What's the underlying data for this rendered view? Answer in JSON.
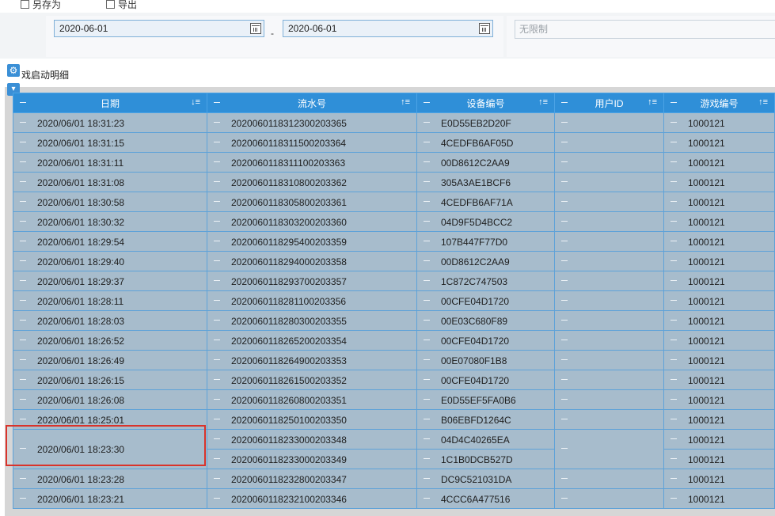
{
  "toolbar": {
    "save_as": "另存为",
    "export": "导出"
  },
  "filters": {
    "start_date": "2020-06-01",
    "separator": "-",
    "end_date": "2020-06-01",
    "unlimited_placeholder": "无限制"
  },
  "section": {
    "title": "戏启动明细"
  },
  "table": {
    "columns": [
      {
        "label": "日期",
        "sort": "↓≡"
      },
      {
        "label": "流水号",
        "sort": "↑≡"
      },
      {
        "label": "设备编号",
        "sort": "↑≡"
      },
      {
        "label": "用户ID",
        "sort": "↑≡"
      },
      {
        "label": "游戏编号",
        "sort": "↑≡"
      }
    ],
    "rows": [
      {
        "date": "2020/06/01 18:31:23",
        "serial": "2020060118312300203365",
        "device": "E0D55EB2D20F",
        "user": "",
        "game": "1000121"
      },
      {
        "date": "2020/06/01 18:31:15",
        "serial": "2020060118311500203364",
        "device": "4CEDFB6AF05D",
        "user": "",
        "game": "1000121"
      },
      {
        "date": "2020/06/01 18:31:11",
        "serial": "2020060118311100203363",
        "device": "00D8612C2AA9",
        "user": "",
        "game": "1000121"
      },
      {
        "date": "2020/06/01 18:31:08",
        "serial": "2020060118310800203362",
        "device": "305A3AE1BCF6",
        "user": "",
        "game": "1000121"
      },
      {
        "date": "2020/06/01 18:30:58",
        "serial": "2020060118305800203361",
        "device": "4CEDFB6AF71A",
        "user": "",
        "game": "1000121"
      },
      {
        "date": "2020/06/01 18:30:32",
        "serial": "2020060118303200203360",
        "device": "04D9F5D4BCC2",
        "user": "",
        "game": "1000121"
      },
      {
        "date": "2020/06/01 18:29:54",
        "serial": "2020060118295400203359",
        "device": "107B447F77D0",
        "user": "",
        "game": "1000121"
      },
      {
        "date": "2020/06/01 18:29:40",
        "serial": "2020060118294000203358",
        "device": "00D8612C2AA9",
        "user": "",
        "game": "1000121"
      },
      {
        "date": "2020/06/01 18:29:37",
        "serial": "2020060118293700203357",
        "device": "1C872C747503",
        "user": "",
        "game": "1000121"
      },
      {
        "date": "2020/06/01 18:28:11",
        "serial": "2020060118281100203356",
        "device": "00CFE04D1720",
        "user": "",
        "game": "1000121"
      },
      {
        "date": "2020/06/01 18:28:03",
        "serial": "2020060118280300203355",
        "device": "00E03C680F89",
        "user": "",
        "game": "1000121"
      },
      {
        "date": "2020/06/01 18:26:52",
        "serial": "2020060118265200203354",
        "device": "00CFE04D1720",
        "user": "",
        "game": "1000121"
      },
      {
        "date": "2020/06/01 18:26:49",
        "serial": "2020060118264900203353",
        "device": "00E07080F1B8",
        "user": "",
        "game": "1000121"
      },
      {
        "date": "2020/06/01 18:26:15",
        "serial": "2020060118261500203352",
        "device": "00CFE04D1720",
        "user": "",
        "game": "1000121"
      },
      {
        "date": "2020/06/01 18:26:08",
        "serial": "2020060118260800203351",
        "device": "E0D55EF5FA0B6",
        "user": "",
        "game": "1000121"
      },
      {
        "date": "2020/06/01 18:25:01",
        "serial": "2020060118250100203350",
        "device": "B06EBFD1264C",
        "user": "",
        "game": "1000121"
      },
      {
        "date": "2020/06/01 18:23:30",
        "serial": "2020060118233000203348",
        "device": "04D4C40265EA",
        "user": "",
        "game": "1000121",
        "merged_serial": "2020060118233000203349",
        "merged_device": "1C1B0DCB527D",
        "merged_game": "1000121"
      },
      {
        "date": "2020/06/01 18:23:28",
        "serial": "2020060118232800203347",
        "device": "DC9C521031DA",
        "user": "",
        "game": "1000121"
      },
      {
        "date": "2020/06/01 18:23:21",
        "serial": "2020060118232100203346",
        "device": "4CCC6A477516",
        "user": "",
        "game": "1000121"
      }
    ]
  }
}
